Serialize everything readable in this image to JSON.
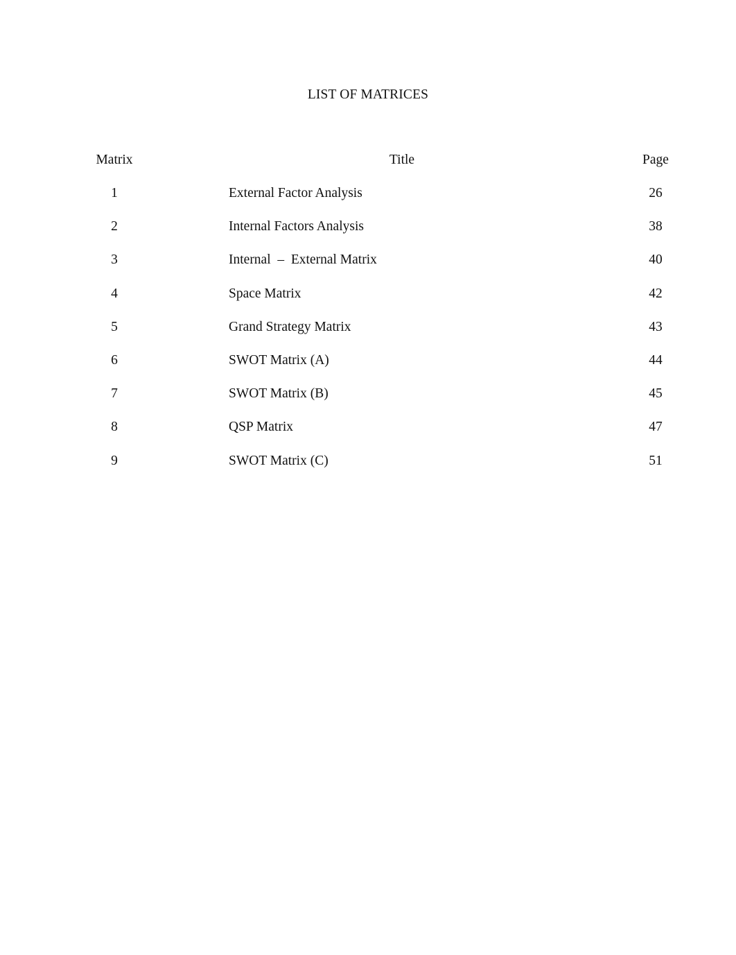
{
  "document": {
    "title": "LIST OF MATRICES",
    "background_color": "#ffffff",
    "text_color": "#111111"
  },
  "table": {
    "headers": {
      "matrix": "Matrix",
      "title": "Title",
      "page": "Page"
    },
    "rows": [
      {
        "matrix": "1",
        "title": "External Factor Analysis",
        "page": "26"
      },
      {
        "matrix": "2",
        "title": "Internal Factors Analysis",
        "page": "38"
      },
      {
        "matrix": "3",
        "title": "Internal  –  External Matrix",
        "page": "40"
      },
      {
        "matrix": "4",
        "title": "Space Matrix",
        "page": "42"
      },
      {
        "matrix": "5",
        "title": "Grand Strategy Matrix",
        "page": "43"
      },
      {
        "matrix": "6",
        "title": "SWOT Matrix (A)",
        "page": "44"
      },
      {
        "matrix": "7",
        "title": "SWOT Matrix (B)",
        "page": "45"
      },
      {
        "matrix": "8",
        "title": "QSP Matrix",
        "page": "47"
      },
      {
        "matrix": "9",
        "title": "SWOT Matrix (C)",
        "page": "51"
      }
    ]
  }
}
